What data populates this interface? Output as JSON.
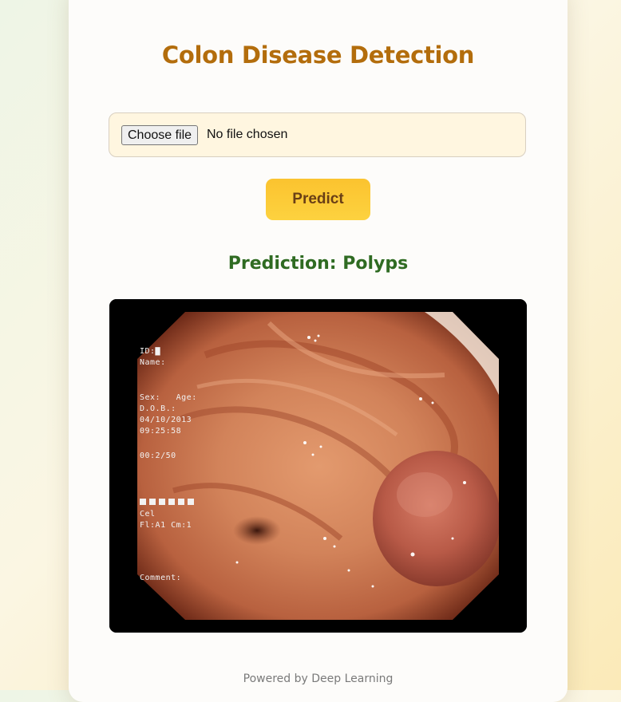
{
  "app": {
    "title": "Colon Disease Detection",
    "footer": "Powered by Deep Learning"
  },
  "upload": {
    "button_label": "Choose file",
    "status": "No file chosen"
  },
  "predict_button": {
    "label": "Predict"
  },
  "result": {
    "prediction_text": "Prediction: Polyps"
  },
  "endoscopy_overlay": {
    "id": "ID:▇",
    "name": "Name:",
    "sex_age": "Sex:   Age:",
    "dob": "D.O.B.:",
    "date": "04/10/2013",
    "time": "09:25:58",
    "elapsed": "00:2/50",
    "line_ce": "Cel",
    "line_fl": "Fl:A1 Cm:1",
    "comment": "Comment:"
  }
}
